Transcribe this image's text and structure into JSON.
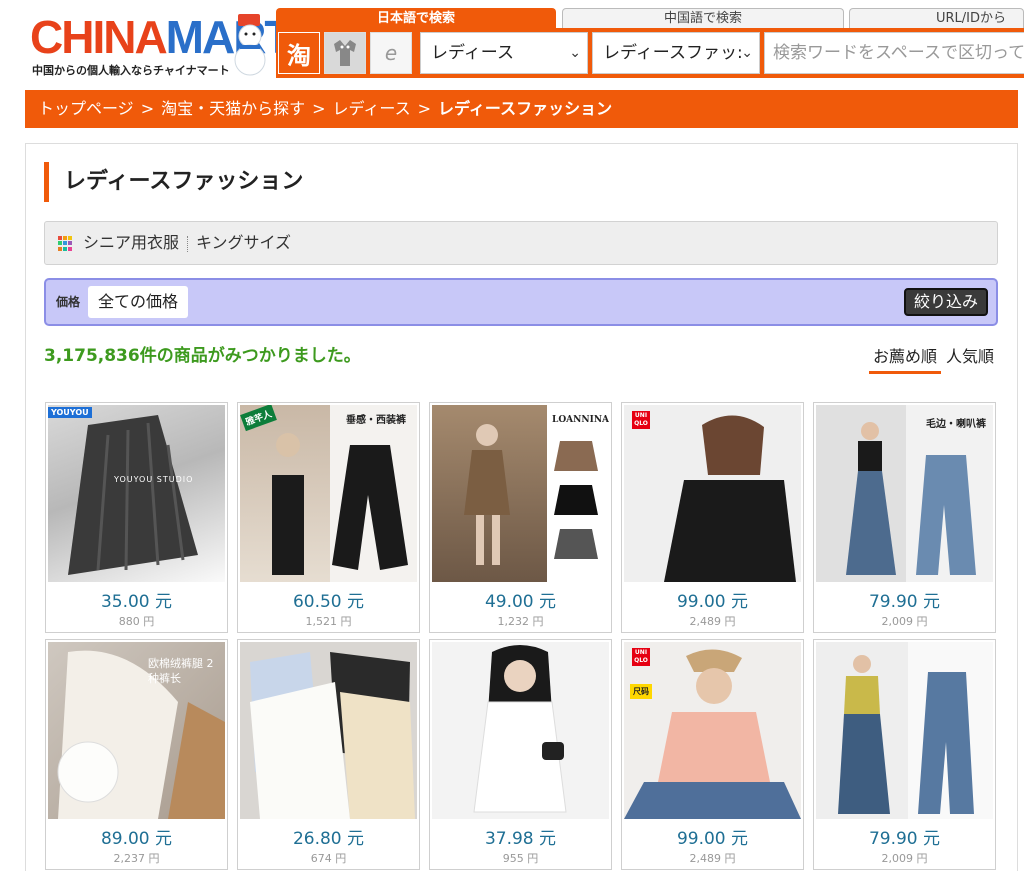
{
  "logo": {
    "part1": "CHINA",
    "part2": "MART",
    "tagline": "中国からの個人輸入ならチャイナマート"
  },
  "search_tabs": [
    {
      "label": "日本語で検索"
    },
    {
      "label": "中国語で検索"
    },
    {
      "label": "URL/IDから"
    }
  ],
  "search": {
    "taobao_glyph": "淘",
    "ename_glyph": "e",
    "category": "レディース",
    "subcategory": "レディースファッ:",
    "placeholder": "検索ワードをスペースで区切って入"
  },
  "breadcrumb": {
    "items": [
      "トップページ",
      "淘宝・天猫から探す",
      "レディース"
    ],
    "separator": ">",
    "current": "レディースファッション"
  },
  "page_title": "レディースファッション",
  "subcategories": [
    "シニア用衣服",
    "キングサイズ"
  ],
  "filter": {
    "label": "価格",
    "value": "全ての価格",
    "button": "絞り込み"
  },
  "results_text": "3,175,836件の商品がみつかりました。",
  "sort_options": [
    {
      "label": "お薦め順",
      "active": true
    },
    {
      "label": "人気順",
      "active": false
    }
  ],
  "products": [
    {
      "price": "35.00 元",
      "yen": "880 円",
      "overlay": "YOUYOU STUDIO",
      "brand": "YOUYOU"
    },
    {
      "price": "60.50 元",
      "yen": "1,521 円",
      "overlay": "垂感・西装裤",
      "brand": "雅芊人"
    },
    {
      "price": "49.00 元",
      "yen": "1,232 円",
      "overlay": "LOANNINA",
      "brand": ""
    },
    {
      "price": "99.00 元",
      "yen": "2,489 円",
      "overlay": "",
      "brand": "UNI QLO"
    },
    {
      "price": "79.90 元",
      "yen": "2,009 円",
      "overlay": "毛边・喇叭裤",
      "brand": ""
    },
    {
      "price": "89.00 元",
      "yen": "2,237 円",
      "overlay": "欧棉绒裤腿 2种裤长",
      "brand": ""
    },
    {
      "price": "26.80 元",
      "yen": "674 円",
      "overlay": "",
      "brand": ""
    },
    {
      "price": "37.98 元",
      "yen": "955 円",
      "overlay": "",
      "brand": ""
    },
    {
      "price": "99.00 元",
      "yen": "2,489 円",
      "overlay": "尺码",
      "brand": "UNI QLO"
    },
    {
      "price": "79.90 元",
      "yen": "2,009 円",
      "overlay": "",
      "brand": ""
    }
  ],
  "colors": {
    "accent": "#f05a0a",
    "price": "#1f6f94",
    "results": "#3d9a1e",
    "filter_bg": "#c8c8f8"
  }
}
